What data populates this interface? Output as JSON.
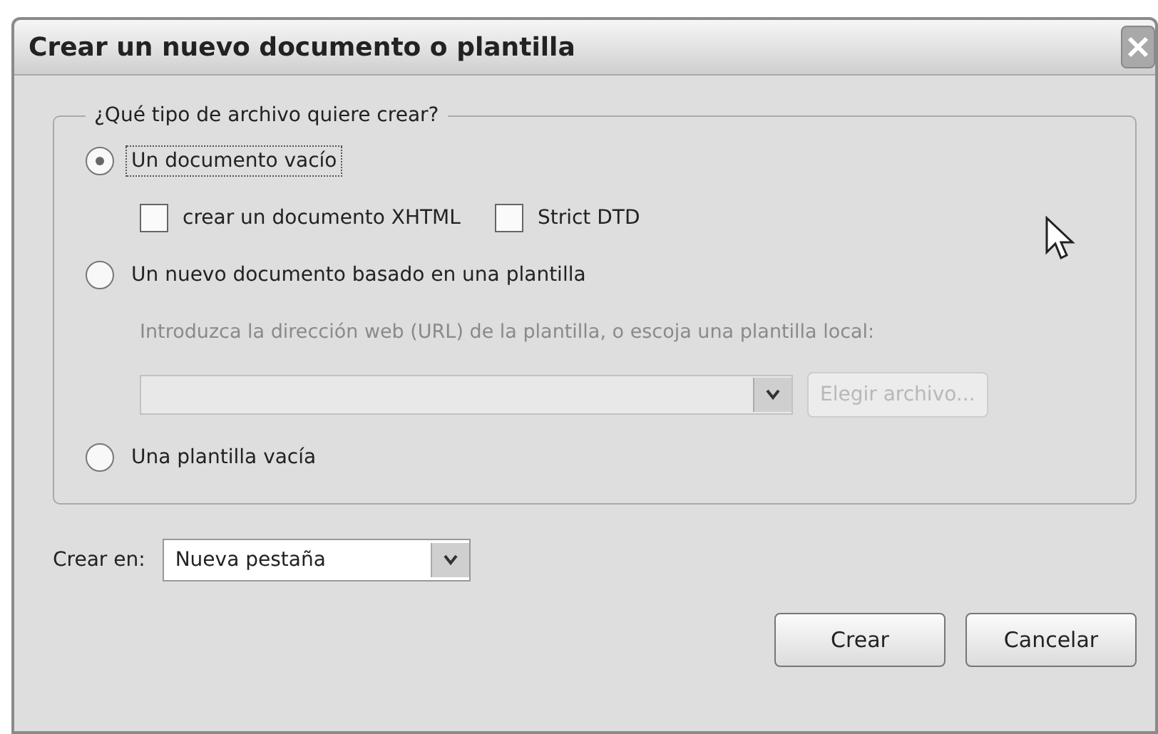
{
  "window": {
    "title": "Crear un nuevo documento o plantilla"
  },
  "group": {
    "legend": "¿Qué tipo de archivo quiere crear?",
    "options": [
      {
        "kind": "radio",
        "label": "Un documento vacío",
        "selected": true
      },
      {
        "kind": "checkboxes",
        "items": [
          {
            "label": "crear un documento XHTML",
            "checked": false
          },
          {
            "label": "Strict DTD",
            "checked": false
          }
        ]
      },
      {
        "kind": "radio",
        "label": "Un nuevo documento basado en una plantilla",
        "selected": false
      },
      {
        "kind": "hint",
        "text": "Introduzca la dirección web (URL) de la plantilla, o escoja una plantilla local:",
        "disabled": true
      },
      {
        "kind": "url-row",
        "disabled": true,
        "button": "Elegir archivo..."
      },
      {
        "kind": "radio",
        "label": "Una plantilla vacía",
        "selected": false
      }
    ]
  },
  "create_in": {
    "label": "Crear en:",
    "value": "Nueva pestaña"
  },
  "buttons": [
    "Crear",
    "Cancelar"
  ]
}
